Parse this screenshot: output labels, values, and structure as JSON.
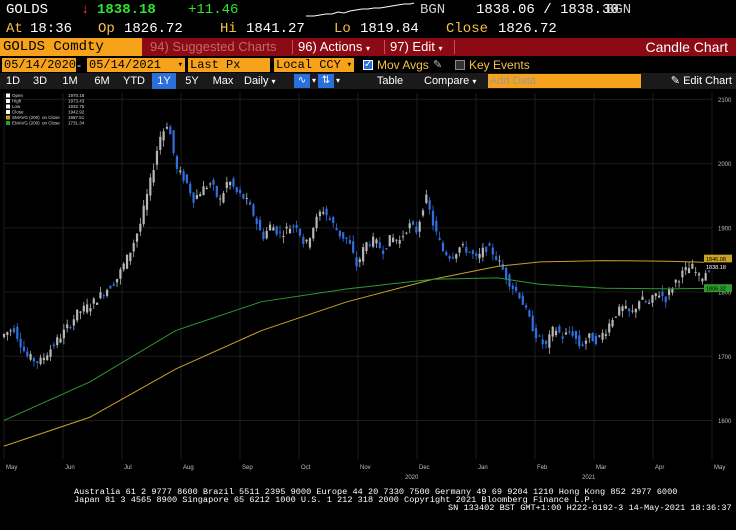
{
  "quote": {
    "ticker": "GOLDS",
    "direction_icon": "down-arrow-icon",
    "last": "1838.18",
    "change": "+11.46",
    "source1": "BGN",
    "bid_ask": "1838.06 / 1838.30",
    "source2": "BGN",
    "at_label": "At",
    "at_value": "18:36",
    "open_label": "Op",
    "open_value": "1826.72",
    "high_label": "Hi",
    "high_value": "1841.27",
    "low_label": "Lo",
    "low_value": "1819.84",
    "close_label": "Close",
    "close_value": "1826.72"
  },
  "menubar": {
    "security": "GOLDS Comdty",
    "suggested_num": "94)",
    "suggested_label": "Suggested Charts",
    "actions_num": "96)",
    "actions_label": "Actions",
    "edit_num": "97)",
    "edit_label": "Edit",
    "title": "Candle Chart"
  },
  "options": {
    "start_date": "05/14/2020",
    "end_date": "05/14/2021",
    "field": "Last Px",
    "currency": "Local CCY",
    "mov_avgs_label": "Mov Avgs",
    "mov_avgs_checked": true,
    "key_events_label": "Key Events",
    "key_events_checked": false
  },
  "toolbar": {
    "ranges": [
      "1D",
      "3D",
      "1M",
      "6M",
      "YTD",
      "1Y",
      "5Y",
      "Max"
    ],
    "selected_range": "1Y",
    "frequency": "Daily",
    "table_label": "Table",
    "compare_label": "Compare",
    "add_data_placeholder": "Add Data",
    "edit_chart_label": "Edit Chart"
  },
  "colors": {
    "bull": "#b7b7b7",
    "bear": "#2f6fe0",
    "sma": "#c9a227",
    "ema": "#2f9a2f",
    "grid": "#1c1c1c",
    "axis_text": "#bfbfbf"
  },
  "chart_data": {
    "type": "candlestick",
    "legend": [
      {
        "name": "Open",
        "value": "1970.18"
      },
      {
        "name": "High",
        "value": "1973.43"
      },
      {
        "name": "Low",
        "value": "1932.75"
      },
      {
        "name": "Close",
        "value": "1942.92"
      },
      {
        "name": "SMAVG (200)",
        "sub": "on Close",
        "value": "1687.51"
      },
      {
        "name": "EMAVG (200)",
        "sub": "on Close",
        "value": "1731.34"
      }
    ],
    "ylim": [
      1540,
      2110
    ],
    "yticks": [
      1600,
      1700,
      1800,
      1900,
      2000,
      2100
    ],
    "x_months": [
      "May",
      "Jun",
      "Jul",
      "Aug",
      "Sep",
      "Oct",
      "Nov",
      "Dec",
      "Jan",
      "Feb",
      "Mar",
      "Apr",
      "May"
    ],
    "x_years": [
      {
        "label": "2020",
        "at_month": 7
      },
      {
        "label": "2021",
        "at_month": 10
      }
    ],
    "last_price_tag": "1838.18",
    "sma_tag": "1846.08",
    "ema_tag": "1806.32",
    "close_path": [
      [
        0,
        1730
      ],
      [
        6,
        1745
      ],
      [
        12,
        1700
      ],
      [
        18,
        1690
      ],
      [
        24,
        1715
      ],
      [
        30,
        1740
      ],
      [
        36,
        1768
      ],
      [
        42,
        1780
      ],
      [
        48,
        1800
      ],
      [
        54,
        1820
      ],
      [
        60,
        1860
      ],
      [
        65,
        1905
      ],
      [
        70,
        1975
      ],
      [
        74,
        2040
      ],
      [
        78,
        2065
      ],
      [
        82,
        1990
      ],
      [
        86,
        1975
      ],
      [
        90,
        1945
      ],
      [
        94,
        1960
      ],
      [
        98,
        1970
      ],
      [
        102,
        1940
      ],
      [
        106,
        1975
      ],
      [
        110,
        1955
      ],
      [
        114,
        1945
      ],
      [
        118,
        1920
      ],
      [
        122,
        1885
      ],
      [
        126,
        1905
      ],
      [
        130,
        1890
      ],
      [
        134,
        1900
      ],
      [
        138,
        1905
      ],
      [
        142,
        1870
      ],
      [
        146,
        1905
      ],
      [
        150,
        1930
      ],
      [
        154,
        1910
      ],
      [
        158,
        1890
      ],
      [
        162,
        1880
      ],
      [
        166,
        1840
      ],
      [
        170,
        1875
      ],
      [
        174,
        1880
      ],
      [
        178,
        1865
      ],
      [
        182,
        1885
      ],
      [
        186,
        1880
      ],
      [
        190,
        1905
      ],
      [
        194,
        1895
      ],
      [
        198,
        1950
      ],
      [
        202,
        1900
      ],
      [
        206,
        1865
      ],
      [
        210,
        1855
      ],
      [
        214,
        1870
      ],
      [
        218,
        1865
      ],
      [
        222,
        1850
      ],
      [
        226,
        1870
      ],
      [
        230,
        1860
      ],
      [
        234,
        1835
      ],
      [
        238,
        1810
      ],
      [
        242,
        1795
      ],
      [
        246,
        1760
      ],
      [
        250,
        1730
      ],
      [
        254,
        1715
      ],
      [
        258,
        1745
      ],
      [
        262,
        1730
      ],
      [
        266,
        1740
      ],
      [
        270,
        1715
      ],
      [
        274,
        1730
      ],
      [
        278,
        1725
      ],
      [
        282,
        1740
      ],
      [
        286,
        1765
      ],
      [
        290,
        1775
      ],
      [
        294,
        1765
      ],
      [
        298,
        1790
      ],
      [
        302,
        1780
      ],
      [
        306,
        1800
      ],
      [
        310,
        1790
      ],
      [
        314,
        1815
      ],
      [
        318,
        1830
      ],
      [
        322,
        1840
      ],
      [
        326,
        1820
      ],
      [
        330,
        1838
      ]
    ],
    "sma_path": [
      [
        0,
        1560
      ],
      [
        40,
        1605
      ],
      [
        80,
        1680
      ],
      [
        120,
        1740
      ],
      [
        160,
        1785
      ],
      [
        200,
        1820
      ],
      [
        230,
        1840
      ],
      [
        250,
        1847
      ],
      [
        280,
        1849
      ],
      [
        310,
        1848
      ],
      [
        330,
        1846
      ]
    ],
    "ema_path": [
      [
        0,
        1600
      ],
      [
        40,
        1660
      ],
      [
        80,
        1740
      ],
      [
        120,
        1785
      ],
      [
        160,
        1805
      ],
      [
        200,
        1820
      ],
      [
        230,
        1822
      ],
      [
        250,
        1812
      ],
      [
        280,
        1806
      ],
      [
        310,
        1805
      ],
      [
        330,
        1806
      ]
    ]
  },
  "footer": {
    "line1": "Australia 61 2 9777 8600 Brazil 5511 2395 9000 Europe 44 20 7330 7500 Germany 49 69 9204 1210 Hong Kong 852 2977 6000",
    "line2": "Japan 81 3 4565 8900        Singapore 65 6212 1000        U.S. 1 212 318 2000        Copyright 2021 Bloomberg Finance L.P.",
    "line3": "SN 133402 BST  GMT+1:00 H222-8192-3 14-May-2021 18:36:37"
  }
}
